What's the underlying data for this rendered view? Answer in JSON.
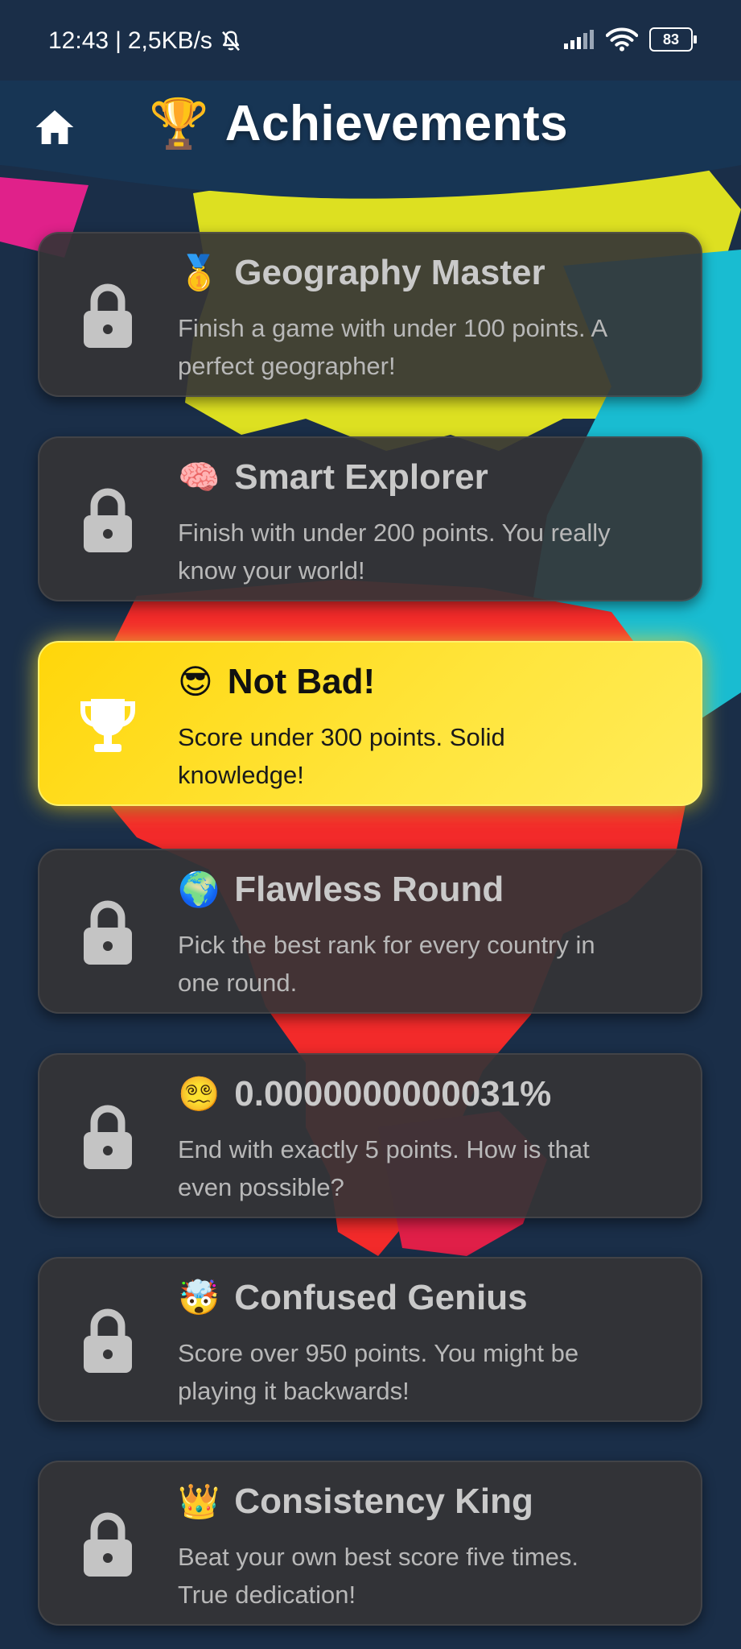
{
  "status_bar": {
    "time": "12:43",
    "network_speed": "2,5KB/s",
    "battery": "83"
  },
  "header": {
    "title_emoji": "🏆",
    "title": "Achievements"
  },
  "colors": {
    "background": "#1a2e48",
    "card_locked": "#343436",
    "card_unlocked": "#ffe01a",
    "lock_icon": "#c4c4c4"
  },
  "achievements": [
    {
      "emoji": "🥇",
      "title": "Geography Master",
      "desc_line1": "Finish a game with under 100 points. A",
      "desc_line2": "perfect geographer!",
      "unlocked": false,
      "icon": "lock-icon"
    },
    {
      "emoji": "🧠",
      "title": "Smart Explorer",
      "desc_line1": "Finish with under 200 points. You really",
      "desc_line2": "know your world!",
      "unlocked": false,
      "icon": "lock-icon"
    },
    {
      "emoji": "😎",
      "title": "Not Bad!",
      "desc_line1": "Score under 300 points. Solid",
      "desc_line2": "knowledge!",
      "unlocked": true,
      "icon": "trophy-icon"
    },
    {
      "emoji": "🌍",
      "title": "Flawless Round",
      "desc_line1": "Pick the best rank for every country in",
      "desc_line2": "one round.",
      "unlocked": false,
      "icon": "lock-icon"
    },
    {
      "emoji": "😵‍💫",
      "title": "0.0000000000031%",
      "desc_line1": "End with exactly 5 points. How is that",
      "desc_line2": "even possible?",
      "unlocked": false,
      "icon": "lock-icon"
    },
    {
      "emoji": "🤯",
      "title": "Confused Genius",
      "desc_line1": "Score over 950 points. You might be",
      "desc_line2": "playing it backwards!",
      "unlocked": false,
      "icon": "lock-icon"
    },
    {
      "emoji": "👑",
      "title": "Consistency King",
      "desc_line1": "Beat your own best score five times.",
      "desc_line2": "True dedication!",
      "unlocked": false,
      "icon": "lock-icon"
    }
  ]
}
